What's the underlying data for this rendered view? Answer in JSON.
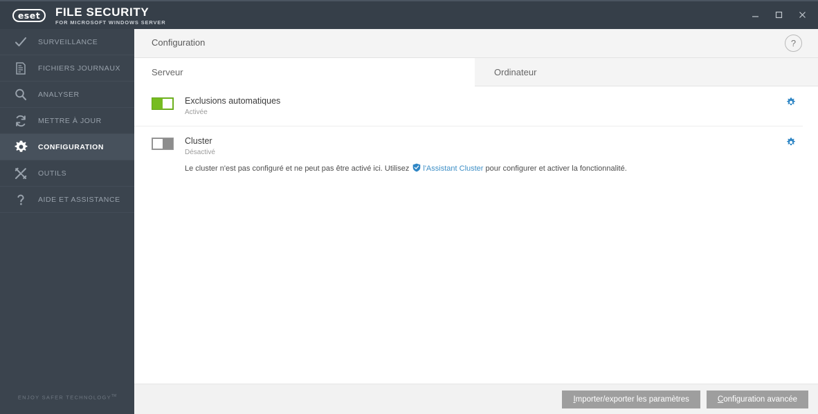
{
  "window": {
    "brand_mark": "eset",
    "product_name": "FILE SECURITY",
    "product_subtitle": "FOR MICROSOFT WINDOWS SERVER",
    "controls": {
      "minimize": "minimize-icon",
      "maximize": "maximize-icon",
      "close": "close-icon"
    }
  },
  "sidebar": {
    "items": [
      {
        "label": "SURVEILLANCE",
        "icon": "check-icon",
        "active": false
      },
      {
        "label": "FICHIERS JOURNAUX",
        "icon": "log-file-icon",
        "active": false
      },
      {
        "label": "ANALYSER",
        "icon": "magnifier-icon",
        "active": false
      },
      {
        "label": "METTRE À JOUR",
        "icon": "refresh-icon",
        "active": false
      },
      {
        "label": "CONFIGURATION",
        "icon": "gear-icon",
        "active": true
      },
      {
        "label": "OUTILS",
        "icon": "tools-icon",
        "active": false
      },
      {
        "label": "AIDE ET ASSISTANCE",
        "icon": "question-mark-icon",
        "active": false
      }
    ],
    "tagline": "ENJOY SAFER TECHNOLOGY",
    "tagline_tm": "TM"
  },
  "header": {
    "title": "Configuration",
    "help_label": "?"
  },
  "tabs": [
    {
      "label": "Serveur",
      "active": true
    },
    {
      "label": "Ordinateur",
      "active": false
    }
  ],
  "settings": [
    {
      "name": "Exclusions automatiques",
      "state": "Activée",
      "enabled": true,
      "gear": "gear-icon"
    },
    {
      "name": "Cluster",
      "state": "Désactivé",
      "enabled": false,
      "gear": "gear-icon",
      "description_before": "Le cluster n'est pas configuré et ne peut pas être activé ici. Utilisez",
      "link_text": "l'Assistant Cluster",
      "description_after": "pour configurer et activer la fonctionnalité."
    }
  ],
  "footer": {
    "import_export_accel": "I",
    "import_export_rest": "mporter/exporter les paramètres",
    "advanced_accel": "C",
    "advanced_rest": "onfiguration avancée"
  },
  "colors": {
    "titlebar": "#363f49",
    "sidebar": "#3b444e",
    "sidebar_active": "#47515c",
    "toggle_on": "#76bc21",
    "toggle_off": "#8d8d8d",
    "accent_link": "#3e8fc6",
    "gear_blue": "#2f86c5"
  }
}
